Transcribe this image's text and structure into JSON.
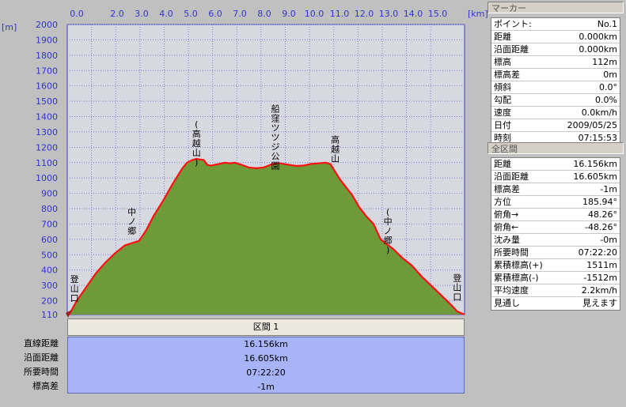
{
  "chart_data": {
    "type": "area",
    "xlabel": "[km]",
    "ylabel": "[m]",
    "x_ticks": [
      "0.0",
      "2.0",
      "3.0",
      "4.0",
      "5.0",
      "6.0",
      "7.0",
      "8.0",
      "9.0",
      "10.0",
      "11.0",
      "12.0",
      "13.0",
      "14.0",
      "15.0"
    ],
    "y_ticks": [
      "2000",
      "1900",
      "1800",
      "1700",
      "1600",
      "1500",
      "1400",
      "1300",
      "1200",
      "1100",
      "1000",
      "900",
      "800",
      "700",
      "600",
      "500",
      "400",
      "300",
      "200",
      "110"
    ],
    "xlim": [
      0,
      16.605
    ],
    "ylim": [
      110,
      2000
    ],
    "grid": true,
    "x": [
      0.0,
      0.1,
      0.4,
      0.8,
      1.2,
      1.6,
      2.0,
      2.4,
      2.8,
      3.0,
      3.3,
      3.6,
      4.0,
      4.4,
      4.8,
      5.0,
      5.2,
      5.4,
      5.55,
      5.7,
      5.85,
      6.0,
      6.3,
      6.6,
      6.8,
      7.0,
      7.3,
      7.6,
      7.9,
      8.2,
      8.6,
      8.9,
      9.1,
      9.3,
      9.6,
      9.9,
      10.2,
      10.5,
      10.8,
      11.0,
      11.2,
      11.4,
      11.6,
      11.9,
      12.2,
      12.5,
      12.8,
      13.1,
      13.3,
      13.6,
      14.0,
      14.4,
      14.8,
      15.2,
      15.6,
      16.0,
      16.3,
      16.605
    ],
    "y": [
      112,
      115,
      200,
      290,
      380,
      450,
      510,
      560,
      580,
      590,
      660,
      750,
      850,
      960,
      1060,
      1100,
      1115,
      1125,
      1120,
      1118,
      1085,
      1080,
      1090,
      1100,
      1095,
      1100,
      1085,
      1068,
      1064,
      1068,
      1092,
      1095,
      1090,
      1085,
      1078,
      1082,
      1092,
      1095,
      1100,
      1090,
      1040,
      990,
      950,
      890,
      810,
      750,
      700,
      600,
      575,
      540,
      480,
      430,
      360,
      300,
      240,
      180,
      130,
      110
    ],
    "annotations": [
      {
        "text": "登山口",
        "x": 0.3,
        "y": 320
      },
      {
        "text": "中ノ郷",
        "x": 2.7,
        "y": 760
      },
      {
        "text": "(高越山)",
        "x": 5.4,
        "y": 1330
      },
      {
        "text": "船窪ツツジ公園",
        "x": 8.7,
        "y": 1430
      },
      {
        "text": "高越山",
        "x": 11.2,
        "y": 1230
      },
      {
        "text": "(中ノ郷)",
        "x": 13.4,
        "y": 760
      },
      {
        "text": "登山口",
        "x": 16.3,
        "y": 330
      }
    ]
  },
  "marker_panel": {
    "title": "マーカー",
    "rows": [
      {
        "label": "ポイント:",
        "value": "No.1"
      },
      {
        "label": "距離",
        "value": "0.000km"
      },
      {
        "label": "沿面距離",
        "value": "0.000km"
      },
      {
        "label": "標高",
        "value": "112m"
      },
      {
        "label": "標高差",
        "value": "0m"
      },
      {
        "label": "傾斜",
        "value": "0.0°"
      },
      {
        "label": "勾配",
        "value": "0.0%"
      },
      {
        "label": "速度",
        "value": "0.0km/h"
      },
      {
        "label": "日付",
        "value": "2009/05/25"
      },
      {
        "label": "時刻",
        "value": "07:15:53"
      }
    ]
  },
  "section_panel": {
    "title": "全区間",
    "rows": [
      {
        "label": "距離",
        "value": "16.156km"
      },
      {
        "label": "沿面距離",
        "value": "16.605km"
      },
      {
        "label": "標高差",
        "value": "-1m"
      },
      {
        "label": "方位",
        "value": "185.94°"
      },
      {
        "label": "俯角→",
        "value": "48.26°"
      },
      {
        "label": "俯角←",
        "value": "-48.26°"
      },
      {
        "label": "沈み量",
        "value": "-0m"
      },
      {
        "label": "所要時間",
        "value": "07:22:20"
      },
      {
        "label": "累積標高(+)",
        "value": "1511m"
      },
      {
        "label": "累積標高(-)",
        "value": "-1512m"
      },
      {
        "label": "平均速度",
        "value": "2.2km/h"
      },
      {
        "label": "見通し",
        "value": "見えます"
      }
    ]
  },
  "section_bar": {
    "label": "区間 1"
  },
  "stats": {
    "labels": [
      "直線距離",
      "沿面距離",
      "所要時間",
      "標高差"
    ],
    "values": [
      "16.156km",
      "16.605km",
      "07:22:20",
      "-1m"
    ]
  }
}
